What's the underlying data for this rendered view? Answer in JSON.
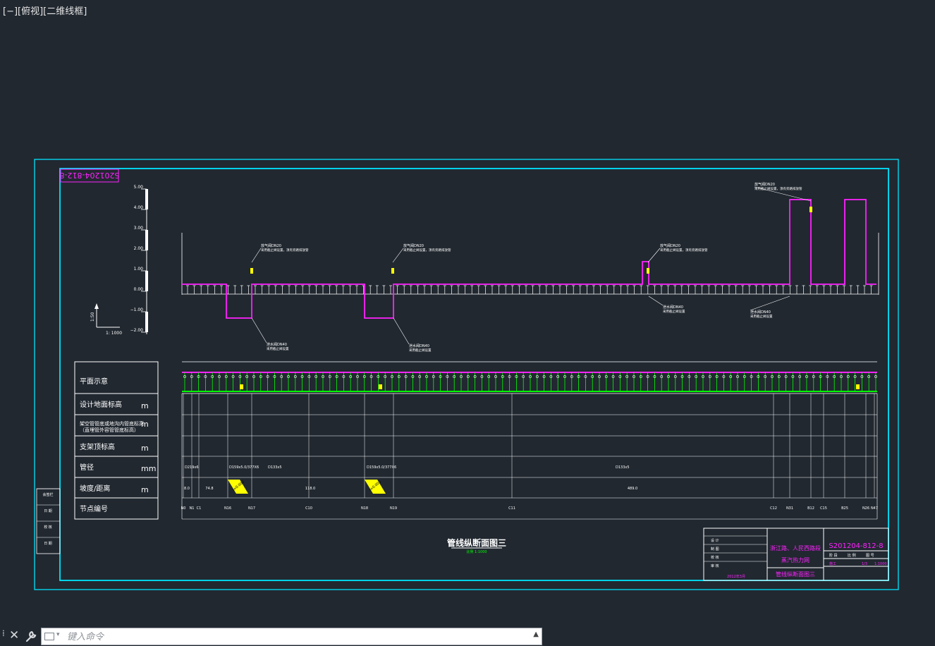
{
  "viewport": {
    "label": "[−][俯视][二维线框]"
  },
  "drawing": {
    "code_rotated": "S201204-812-8",
    "title": "管线纵断面图三",
    "scale_note": "比例 1:1000",
    "scale_h": "1: 1000",
    "scale_v": "1:50",
    "elevation_ticks": [
      "5.00",
      "4.00",
      "3.00",
      "2.00",
      "1.00",
      "0.00",
      "−1.00",
      "−2.00"
    ],
    "row_labels": [
      {
        "label": "平面示意",
        "unit": ""
      },
      {
        "label": "设计地面标高",
        "unit": "m"
      },
      {
        "label": "架空管管底或地沟内管底标高",
        "sub": "（直埋管外容管管底标高）",
        "unit": "m"
      },
      {
        "label": "支架顶标高",
        "unit": "m"
      },
      {
        "label": "管径",
        "unit": "mm"
      },
      {
        "label": "坡度/距离",
        "unit": "m"
      },
      {
        "label": "节点编号",
        "unit": ""
      }
    ],
    "valve_notes": [
      {
        "valve": "放气阀DN20",
        "desc": "采用截止阀设置，须有旁路排放管"
      },
      {
        "valve": "放气阀DN20",
        "desc": "采用截止阀设置，须有旁路排放管"
      },
      {
        "valve": "放气阀DN20",
        "desc": "采用截止阀设置，须有旁路排放管"
      },
      {
        "valve": "放气阀DN20",
        "desc": "采用截止阀设置，须有旁路排放管"
      }
    ],
    "drain_notes": [
      {
        "valve": "泄水阀DN40",
        "desc": "采用截止阀设置"
      },
      {
        "valve": "泄水阀DN40",
        "desc": "采用截止阀设置"
      },
      {
        "valve": "泄水阀DN40",
        "desc": "采用截止阀设置"
      },
      {
        "valve": "泄水阀DN40",
        "desc": "采用截止阀设置"
      }
    ],
    "pipe_sizes": [
      "D219x6",
      "D159x5.0/377X6",
      "D133x5",
      "D159x5.0/377X6",
      "D133x5"
    ],
    "distances": [
      "8.0",
      "74.8",
      "22.0",
      "118.0",
      "22.0",
      "489.0"
    ],
    "slopes": [
      "i=0.003",
      "i=0.003"
    ],
    "node_labels": [
      "N0",
      "N1",
      "C1",
      "N16",
      "N17",
      "C10",
      "N18",
      "N19",
      "C11",
      "C12",
      "N31",
      "B12",
      "C15",
      "B25",
      "N26",
      "N47"
    ],
    "left_strip": [
      "会签栏",
      "日 期",
      "校 核",
      "日 期"
    ],
    "title_block": {
      "project_line1": "浙江路、人民西路段",
      "project_line2": "蒸汽热力网",
      "drawing_name": "管线纵断面图三",
      "drawing_no": "S201204-812-8",
      "roles": [
        "设 计",
        "制 图",
        "校 核",
        "审 核"
      ],
      "headers": [
        "阶 段",
        "比 例",
        "图 号"
      ],
      "stage": "施工",
      "ratio": "1:1000",
      "date": "2012年3月",
      "page": "1/3"
    }
  },
  "command": {
    "placeholder": "键入命令"
  },
  "colors": {
    "bg": "#212830",
    "frame": "#00e5ff",
    "pipe": "#ff22ff",
    "white": "#ffffff",
    "green": "#00ff00",
    "yellow": "#ffff00"
  }
}
